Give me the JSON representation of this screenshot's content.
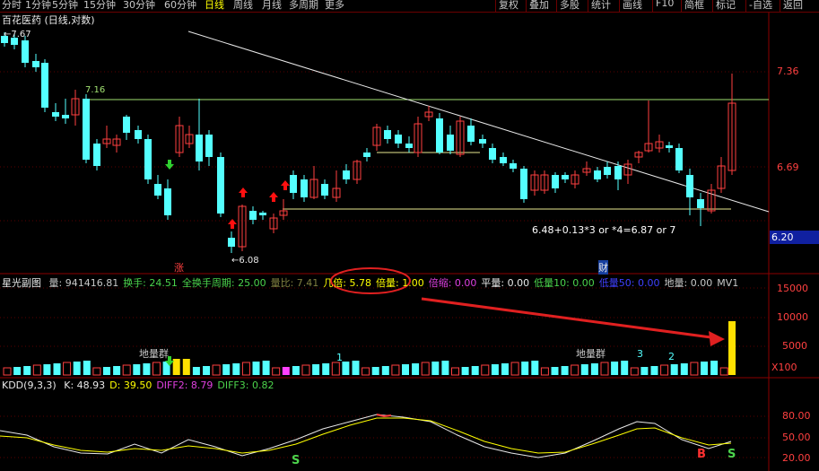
{
  "menu": {
    "items": [
      "分时",
      "1分钟",
      "5分钟",
      "15分钟",
      "30分钟",
      "60分钟",
      "日线",
      "周线",
      "月线",
      "多周期",
      "更多"
    ],
    "active": "日线",
    "right_items": [
      "复权",
      "叠加",
      "多股",
      "统计",
      "画线",
      "F10",
      "简框",
      "标记",
      "-自选",
      "返回"
    ]
  },
  "main_panel": {
    "title": "百花医药 (日线,对数)",
    "price_top_left": "7.67",
    "price_level_line": "7.16",
    "price_low": "6.08",
    "annotation_formula": "6.48+0.13*3 or *4=6.87 or 7",
    "marker_zhang": "涨",
    "marker_cai": "财",
    "axis_labels": [
      "7.36",
      "6.69"
    ],
    "current_price_box": "6.20",
    "colors": {
      "up": "#ff4040",
      "down": "#54ffff",
      "level": "#a0e070",
      "trend": "#e8e8e8"
    }
  },
  "volume_panel": {
    "name": "星光副图",
    "fields": [
      {
        "label": "量:",
        "value": "941416.81",
        "color": "#c8c8c8"
      },
      {
        "label": "换手:",
        "value": "24.51",
        "color": "#4cd44c"
      },
      {
        "label": "全换手周期:",
        "value": "25.00",
        "color": "#4cd44c"
      },
      {
        "label": "量比:",
        "value": "7.41",
        "color": "#808040"
      },
      {
        "label": "几倍:",
        "value": "5.78",
        "color": "#ffff00"
      },
      {
        "label": "倍量:",
        "value": "1.00",
        "color": "#ffff00"
      },
      {
        "label": "倍缩:",
        "value": "0.00",
        "color": "#e040e0"
      },
      {
        "label": "平量:",
        "value": "0.00",
        "color": "#e8e8e8"
      },
      {
        "label": "低量10:",
        "value": "0.00",
        "color": "#4cd44c"
      },
      {
        "label": "低量50:",
        "value": "0.00",
        "color": "#4040ff"
      },
      {
        "label": "地量:",
        "value": "0.00",
        "color": "#c8c8c8"
      },
      {
        "label": "MV1",
        "value": "",
        "color": "#c8c8c8"
      }
    ],
    "tags": [
      "地量群",
      "地量群"
    ],
    "numbers": [
      "1",
      "3",
      "2"
    ],
    "axis_labels": [
      "15000",
      "10000",
      "5000"
    ],
    "unit": "X100"
  },
  "kdd_panel": {
    "name": "KDD(9,3,3)",
    "fields": [
      {
        "label": "K:",
        "value": "48.93",
        "color": "#e8e8e8"
      },
      {
        "label": "D:",
        "value": "39.50",
        "color": "#ffff00"
      },
      {
        "label": "DIFF2:",
        "value": "8.79",
        "color": "#e040e0"
      },
      {
        "label": "DIFF3:",
        "value": "0.82",
        "color": "#4cd44c"
      }
    ],
    "axis_labels": [
      "80.00",
      "50.00",
      "20.00"
    ],
    "signals": [
      "S",
      "B",
      "S"
    ]
  }
}
